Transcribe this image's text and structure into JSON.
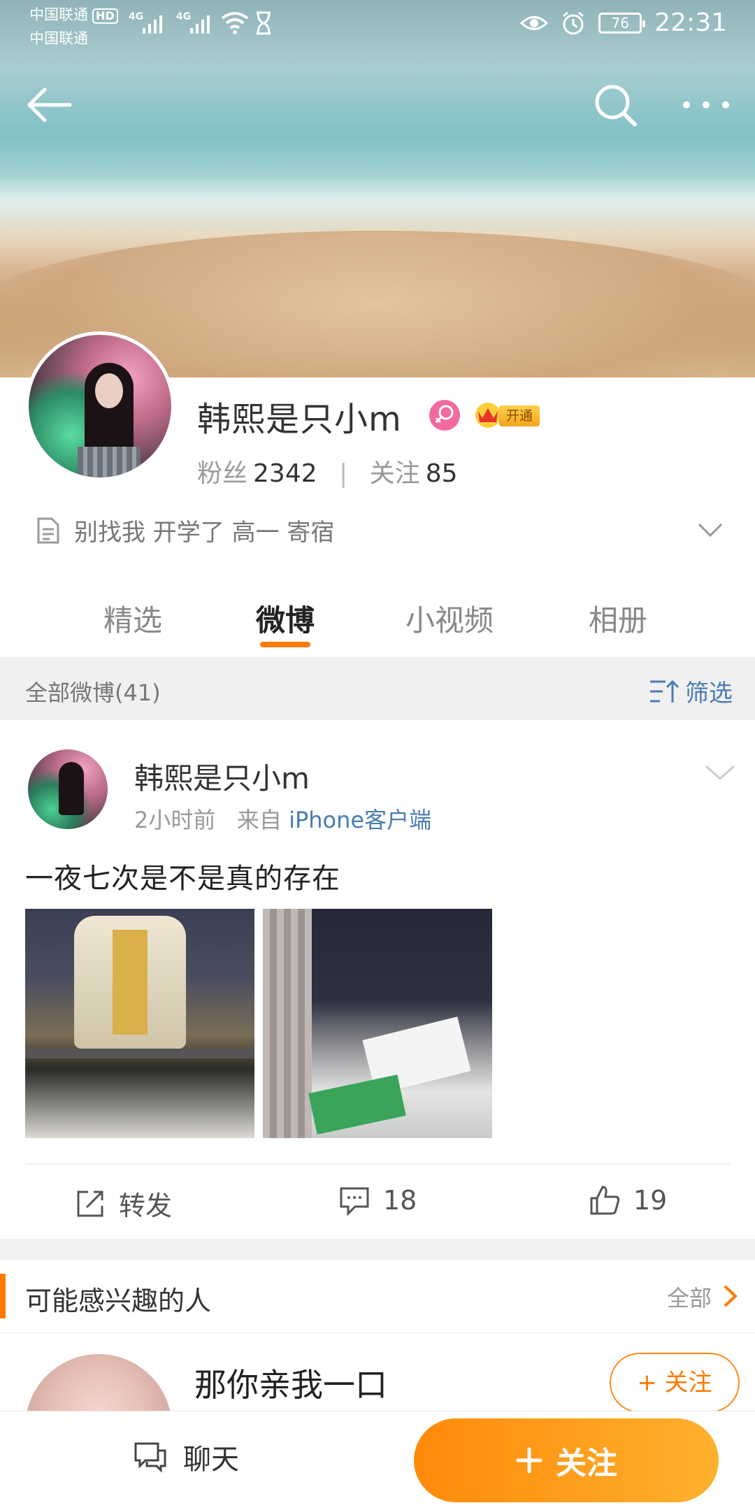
{
  "status_bar": {
    "carrier1": "中国联通",
    "hd": "HD",
    "carrier2": "中国联通",
    "network1": "4G",
    "network2": "4G",
    "battery": "76",
    "time": "22:31"
  },
  "profile": {
    "name": "韩熙是只小m",
    "vip_badge": "开通",
    "fans_label": "粉丝",
    "fans_count": "2342",
    "following_label": "关注",
    "following_count": "85",
    "bio": "别找我 开学了 高一 寄宿"
  },
  "tabs": [
    {
      "label": "精选"
    },
    {
      "label": "微博"
    },
    {
      "label": "小视频"
    },
    {
      "label": "相册"
    }
  ],
  "filter": {
    "count_label": "全部微博(41)",
    "filter_label": "筛选"
  },
  "post": {
    "author": "韩熙是只小m",
    "time": "2小时前",
    "from_label": "来自",
    "source": "iPhone客户端",
    "text": "一夜七次是不是真的存在",
    "repost_label": "转发",
    "comment_count": "18",
    "like_count": "19"
  },
  "suggested": {
    "title": "可能感兴趣的人",
    "all_label": "全部",
    "person_name": "那你亲我一口",
    "follow_label": "+ 关注"
  },
  "bottom": {
    "chat_label": "聊天",
    "follow_label": "关注"
  },
  "colors": {
    "accent": "#ff7a00",
    "link": "#4a7cb3"
  }
}
